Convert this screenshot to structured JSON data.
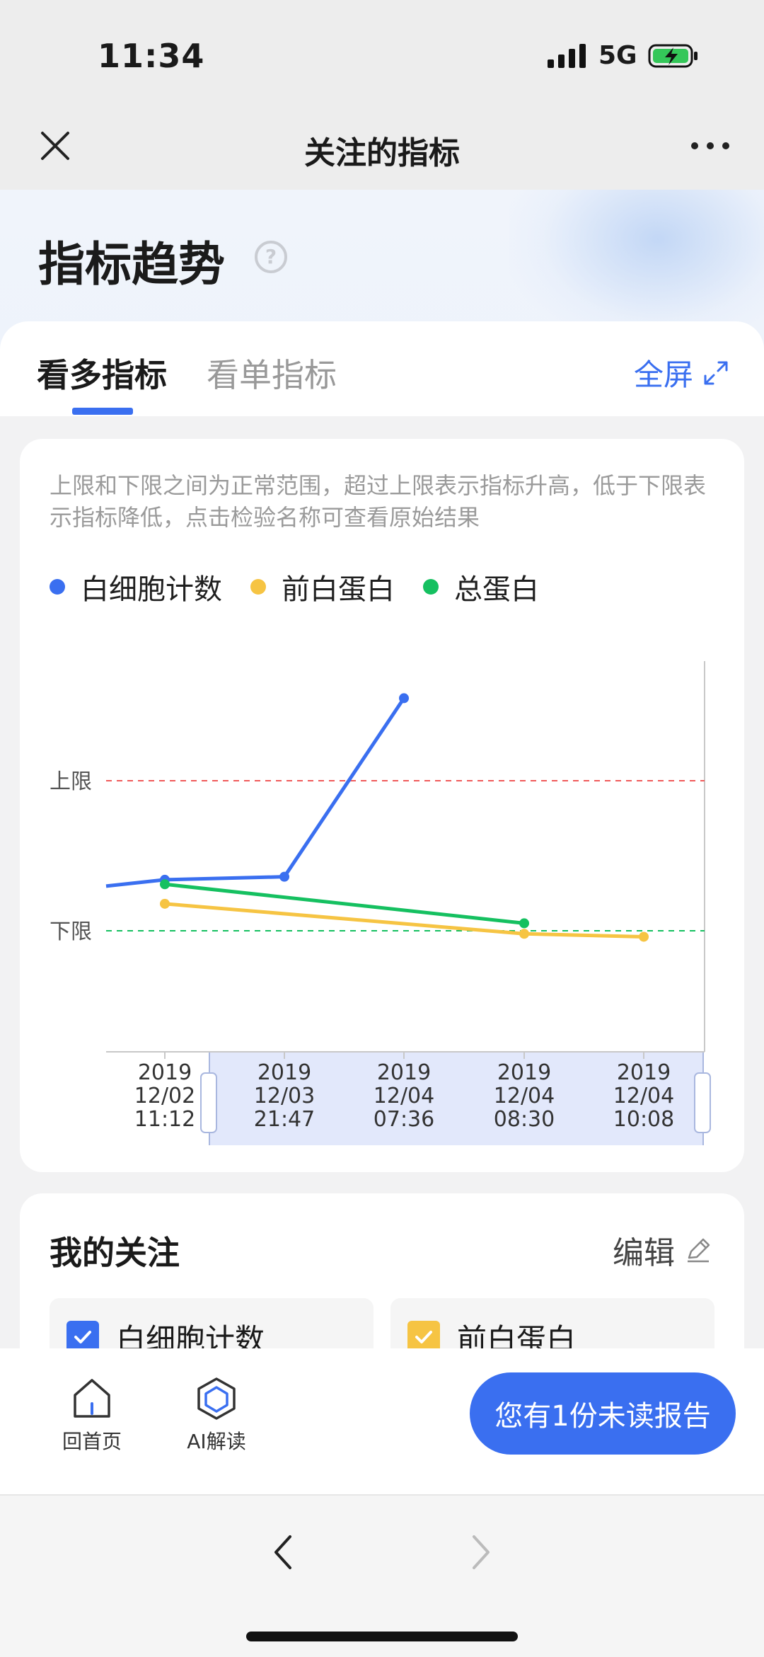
{
  "status_bar": {
    "time": "11:34",
    "network": "5G"
  },
  "nav": {
    "title": "关注的指标",
    "close_icon": "close-icon",
    "more_icon": "more-dots-icon"
  },
  "hero": {
    "title": "指标趋势",
    "help": "?"
  },
  "tabs": [
    {
      "label": "看多指标",
      "active": true
    },
    {
      "label": "看单指标",
      "active": false
    }
  ],
  "fullscreen": {
    "label": "全屏",
    "icon": "expand-icon"
  },
  "chart": {
    "description": "上限和下限之间为正常范围，超过上限表示指标升高，低于下限表示指标降低，点击检验名称可查看原始结果",
    "legend": [
      {
        "name": "白细胞计数",
        "color": "#3a6ff0"
      },
      {
        "name": "前白蛋白",
        "color": "#f6c443"
      },
      {
        "name": "总蛋白",
        "color": "#15c060"
      }
    ],
    "upper_label": "上限",
    "lower_label": "下限"
  },
  "chart_data": {
    "type": "line",
    "x": [
      [
        "2019",
        "12/02",
        "11:12"
      ],
      [
        "2019",
        "12/03",
        "21:47"
      ],
      [
        "2019",
        "12/04",
        "07:36"
      ],
      [
        "2019",
        "12/04",
        "08:30"
      ],
      [
        "2019",
        "12/04",
        "10:08"
      ]
    ],
    "series": [
      {
        "name": "白细胞计数",
        "color": "#3a6ff0",
        "values": [
          0.34,
          0.36,
          1.55,
          null,
          null
        ]
      },
      {
        "name": "前白蛋白",
        "color": "#f6c443",
        "values": [
          0.18,
          null,
          null,
          -0.02,
          -0.04
        ]
      },
      {
        "name": "总蛋白",
        "color": "#15c060",
        "values": [
          0.31,
          null,
          null,
          0.05,
          null
        ]
      }
    ],
    "reference_lines": [
      {
        "label": "上限",
        "value": 1.0,
        "color": "#f05a5a",
        "style": "dashed"
      },
      {
        "label": "下限",
        "value": 0.0,
        "color": "#15c060",
        "style": "dashed"
      }
    ],
    "selected_range": [
      "12/03 21:47",
      "12/04 10:08"
    ],
    "grid": false
  },
  "follow": {
    "title": "我的关注",
    "edit_label": "编辑",
    "chips": [
      {
        "label": "白细胞计数",
        "checked": true,
        "color": "#3a6ff0"
      },
      {
        "label": "前白蛋白",
        "checked": true,
        "color": "#f6c443"
      }
    ]
  },
  "bottom": {
    "home_label": "回首页",
    "ai_label": "AI解读",
    "cta_label": "您有1份未读报告"
  }
}
